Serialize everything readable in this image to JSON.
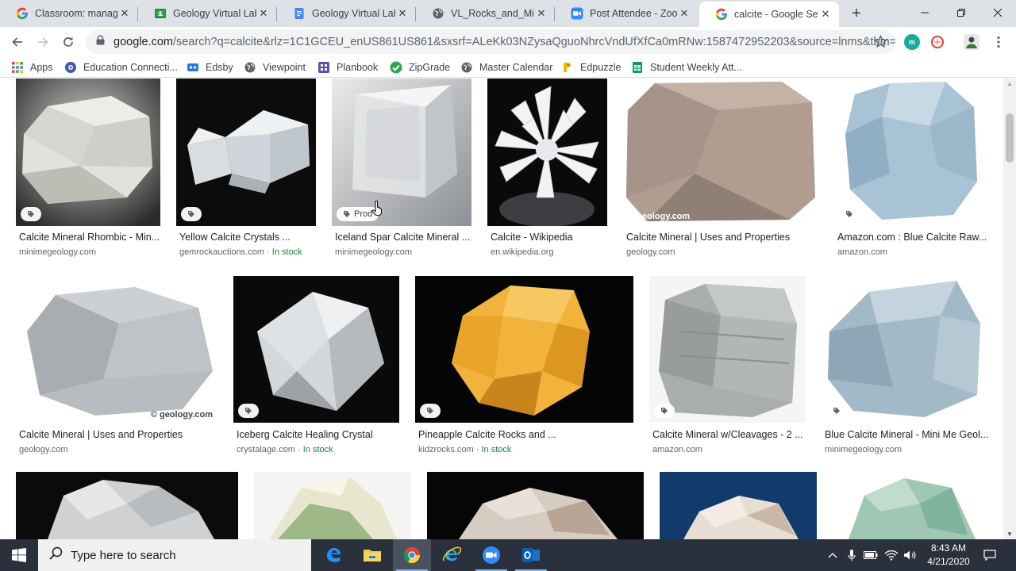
{
  "browser": {
    "tabs": [
      {
        "title": "Classroom: manage",
        "icon": "google-icon",
        "active": false
      },
      {
        "title": "Geology Virtual Lab",
        "icon": "classroom-icon",
        "active": false
      },
      {
        "title": "Geology Virtual Lab",
        "icon": "docs-icon",
        "active": false
      },
      {
        "title": "VL_Rocks_and_Miner",
        "icon": "globe-icon",
        "active": false
      },
      {
        "title": "Post Attendee - Zoo",
        "icon": "zoom-icon",
        "active": false
      },
      {
        "title": "calcite - Google Sea",
        "icon": "google-icon",
        "active": true
      }
    ],
    "url_host": "google.com",
    "url_rest": "/search?q=calcite&rlz=1C1GCEU_enUS861US861&sxsrf=ALeKk03NZysaQguoNhrcVndUfXfCa0mRNw:1587472952203&source=lnms&tbm=...",
    "bookmarks": [
      {
        "label": "Apps",
        "icon": "apps-grid-icon"
      },
      {
        "label": "Education Connecti...",
        "icon": "education-connection-icon"
      },
      {
        "label": "Edsby",
        "icon": "edsby-icon"
      },
      {
        "label": "Viewpoint",
        "icon": "globe-icon"
      },
      {
        "label": "Planbook",
        "icon": "planbook-icon"
      },
      {
        "label": "ZipGrade",
        "icon": "zipgrade-check-icon"
      },
      {
        "label": "Master Calendar",
        "icon": "globe-icon"
      },
      {
        "label": "Edpuzzle",
        "icon": "edpuzzle-icon"
      },
      {
        "label": "Student Weekly Att...",
        "icon": "sheets-icon"
      }
    ]
  },
  "results": {
    "row1": [
      {
        "title": "Calcite Mineral Rhombic - Min...",
        "source": "minimegeology.com",
        "stock": "",
        "tag": "",
        "watermark": "",
        "image": "white rhombic calcite crystal"
      },
      {
        "title": "Yellow Calcite Crystals ...",
        "source": "gemrockauctions.com",
        "stock": "In stock",
        "tag": "",
        "watermark": "",
        "image": "pale calcite crystals on black"
      },
      {
        "title": "Iceland Spar Calcite Mineral ...",
        "source": "minimegeology.com",
        "stock": "",
        "tag": "Prod",
        "watermark": "",
        "image": "clear iceland spar rhomb"
      },
      {
        "title": "Calcite - Wikipedia",
        "source": "en.wikipedia.org",
        "stock": "",
        "tag": "",
        "watermark": "",
        "image": "white calcite flower cluster"
      },
      {
        "title": "Calcite Mineral | Uses and Properties",
        "source": "geology.com",
        "stock": "",
        "tag": "",
        "watermark": "© geology.com",
        "image": "pinkish granular calcite"
      },
      {
        "title": "Amazon.com : Blue Calcite Raw...",
        "source": "amazon.com",
        "stock": "",
        "tag": "",
        "watermark": "",
        "image": "blue calcite raw chunk"
      }
    ],
    "row2": [
      {
        "title": "Calcite Mineral | Uses and Properties",
        "source": "geology.com",
        "stock": "",
        "tag": "",
        "watermark": "© geology.com",
        "image": "grey sparkly calcite"
      },
      {
        "title": "Iceberg Calcite Healing Crystal",
        "source": "crystalage.com",
        "stock": "In stock",
        "tag": "",
        "watermark": "",
        "image": "white iceberg calcite on black"
      },
      {
        "title": "Pineapple Calcite Rocks and ...",
        "source": "kidzrocks.com",
        "stock": "In stock",
        "tag": "",
        "watermark": "",
        "image": "orange pineapple calcite"
      },
      {
        "title": "Calcite Mineral w/Cleavages - 2 ...",
        "source": "amazon.com",
        "stock": "",
        "tag": "",
        "watermark": "",
        "image": "grey cleaved calcite"
      },
      {
        "title": "Blue Calcite Mineral - Mini Me Geol...",
        "source": "minimegeology.com",
        "stock": "",
        "tag": "",
        "watermark": "",
        "image": "blue calcite mineral"
      }
    ],
    "row3": [
      {
        "image": "white calcite cluster on black"
      },
      {
        "image": "green white banded calcite"
      },
      {
        "image": "white calcite on black"
      },
      {
        "image": "white calcite on blue"
      },
      {
        "image": "green calcite"
      }
    ]
  },
  "taskbar": {
    "search_placeholder": "Type here to search",
    "time": "8:43 AM",
    "date": "4/21/2020",
    "apps": [
      "edge-icon",
      "file-explorer-icon",
      "chrome-icon",
      "internet-explorer-icon",
      "zoom-icon",
      "outlook-icon"
    ]
  },
  "colors": {
    "tabstrip": "#dee1e6",
    "link_source": "#5f6368",
    "in_stock": "#188038",
    "taskbar": "#2b313c"
  }
}
